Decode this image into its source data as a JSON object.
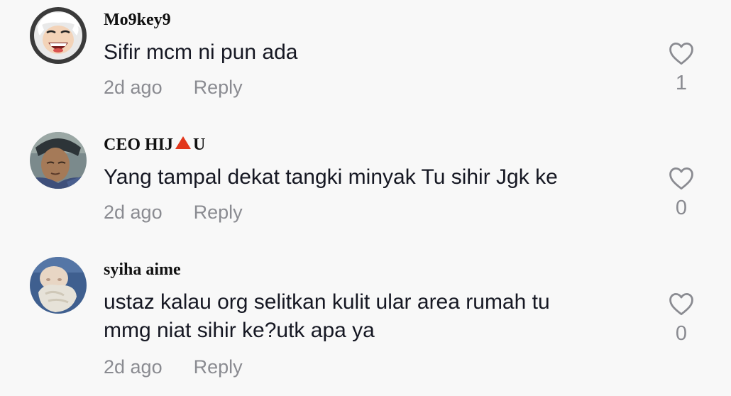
{
  "comments": [
    {
      "username": "Mo9key9",
      "text": "Sifir mcm ni pun ada",
      "time": "2d ago",
      "reply_label": "Reply",
      "likes": "1",
      "avatar": "cartoon-avatar"
    },
    {
      "username_before_flag": "CEO HIJ",
      "username_flag_icon": "red-triangle-icon",
      "username_after_flag": "U",
      "text": "Yang tampal dekat tangki minyak Tu sihir Jgk ke",
      "time": "2d ago",
      "reply_label": "Reply",
      "likes": "0",
      "avatar": "person-photo-avatar"
    },
    {
      "username": "syiha aime",
      "text_line1": "ustaz kalau org selitkan kulit ular area rumah tu",
      "text_line2": "mmg niat sihir ke?utk apa ya",
      "time": "2d ago",
      "reply_label": "Reply",
      "likes": "0",
      "avatar": "baby-photo-avatar"
    }
  ],
  "colors": {
    "background": "#f8f8f8",
    "primary_text": "#161823",
    "secondary_text": "#8a8b91",
    "flag": "#e2371c"
  }
}
